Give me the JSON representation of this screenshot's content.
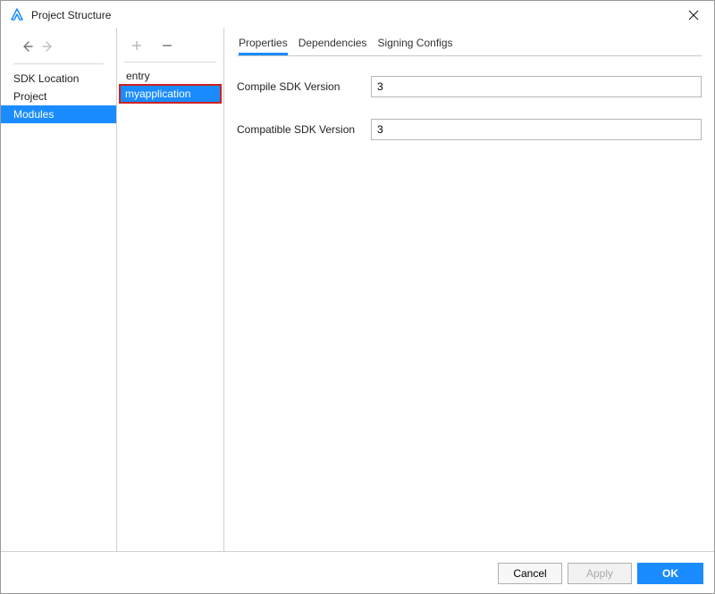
{
  "window": {
    "title": "Project Structure"
  },
  "left_nav": {
    "items": [
      {
        "label": "SDK Location",
        "selected": false
      },
      {
        "label": "Project",
        "selected": false
      },
      {
        "label": "Modules",
        "selected": true
      }
    ]
  },
  "modules": {
    "items": [
      {
        "label": "entry",
        "selected": false,
        "highlighted": false
      },
      {
        "label": "myapplication",
        "selected": true,
        "highlighted": true
      }
    ]
  },
  "tabs": {
    "items": [
      {
        "label": "Properties",
        "active": true
      },
      {
        "label": "Dependencies",
        "active": false
      },
      {
        "label": "Signing Configs",
        "active": false
      }
    ]
  },
  "form": {
    "compile_sdk_label": "Compile SDK Version",
    "compile_sdk_value": "3",
    "compatible_sdk_label": "Compatible SDK Version",
    "compatible_sdk_value": "3"
  },
  "footer": {
    "cancel": "Cancel",
    "apply": "Apply",
    "ok": "OK"
  }
}
